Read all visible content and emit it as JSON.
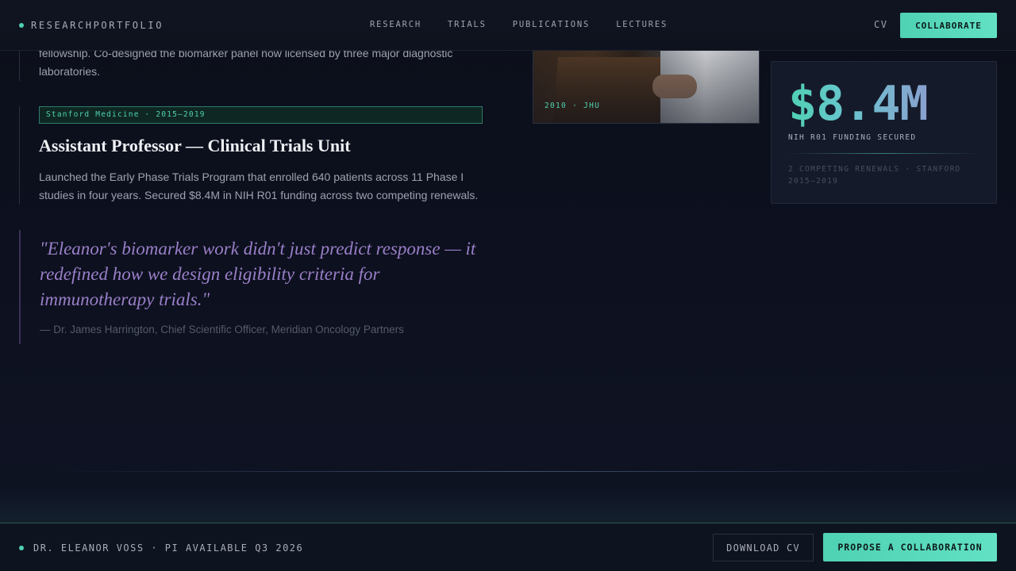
{
  "header": {
    "brand": "RESEARCHPORTFOLIO",
    "nav": [
      "RESEARCH",
      "TRIALS",
      "PUBLICATIONS",
      "LECTURES"
    ],
    "cv_label": "CV",
    "collaborate_label": "COLLABORATE"
  },
  "timeline": {
    "previous_entry_tail": "fellowship. Co-designed the biomarker panel now licensed by three major diagnostic laboratories.",
    "entry": {
      "tag": "Stanford Medicine · 2015–2019",
      "title": "Assistant Professor — Clinical Trials Unit",
      "description": "Launched the Early Phase Trials Program that enrolled 640 patients across 11 Phase I studies in four years. Secured $8.4M in NIH R01 funding across two competing renewals."
    }
  },
  "quote": {
    "text": "\"Eleanor's biomarker work didn't just predict response — it redefined how we design eligibility criteria for immunotherapy trials.\"",
    "attribution": "— Dr. James Harrington, Chief Scientific Officer, Meridian Oncology Partners"
  },
  "photo": {
    "caption": "2010 · JHU"
  },
  "stat": {
    "value": "$8.4M",
    "label": "NIH R01 FUNDING SECURED",
    "sub": "2 COMPETING RENEWALS · STANFORD 2015–2019"
  },
  "footer": {
    "status": "DR. ELEANOR VOSS · PI AVAILABLE Q3 2026",
    "download_label": "DOWNLOAD CV",
    "propose_label": "PROPOSE A COLLABORATION"
  },
  "colors": {
    "accent": "#4fd1b3",
    "quote": "#9a7fc9",
    "background": "#0c0f1a"
  }
}
